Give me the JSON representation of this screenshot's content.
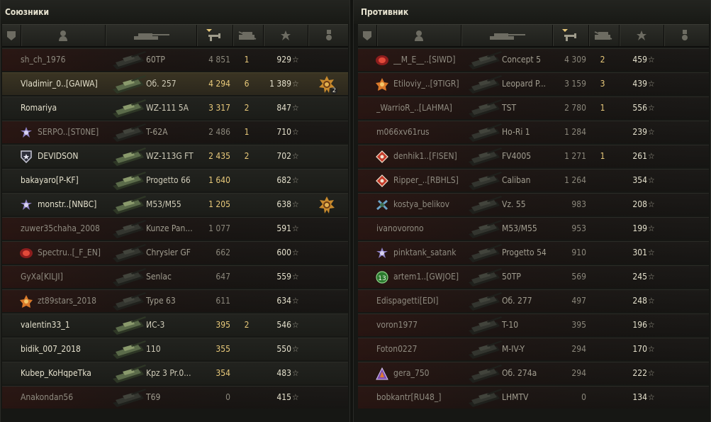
{
  "allies": {
    "title": "Союзники",
    "rows": [
      {
        "name": "sh_ch_1976",
        "tank": "60TP",
        "damage": "4 851",
        "kills": "1",
        "xp": "929",
        "alive": false,
        "emblem": "",
        "medal": ""
      },
      {
        "name": "Vladimir_0..[GAIWA]",
        "tank": "Об. 257",
        "damage": "4 294",
        "kills": "6",
        "xp": "1 389",
        "alive": true,
        "highlight": true,
        "emblem": "",
        "medal": "medal-2",
        "medal_count": "2"
      },
      {
        "name": "Romariya",
        "tank": "WZ-111 5A",
        "damage": "3 317",
        "kills": "2",
        "xp": "847",
        "alive": true,
        "emblem": "",
        "medal": ""
      },
      {
        "name": "SERPO..[ST0NE]",
        "tank": "T-62A",
        "damage": "2 486",
        "kills": "1",
        "xp": "710",
        "alive": false,
        "emblem": "star-emblem",
        "medal": ""
      },
      {
        "name": "DEVIDSON",
        "tank": "WZ-113G FT",
        "damage": "2 435",
        "kills": "2",
        "xp": "702",
        "alive": true,
        "emblem": "shield-emblem",
        "medal": ""
      },
      {
        "name": "bakayaro[P-KF]",
        "tank": "Progetto 66",
        "damage": "1 640",
        "kills": "",
        "xp": "682",
        "alive": true,
        "emblem": "",
        "medal": ""
      },
      {
        "name": "monstr..[NNBC]",
        "tank": "M53/M55",
        "damage": "1 205",
        "kills": "",
        "xp": "638",
        "alive": true,
        "emblem": "star-emblem",
        "medal": "medal-1",
        "medal_count": ""
      },
      {
        "name": "zuwer35chaha_2008",
        "tank": "Kunze Pan...",
        "damage": "1 077",
        "kills": "",
        "xp": "591",
        "alive": false,
        "emblem": "",
        "medal": ""
      },
      {
        "name": "Spectru..[_F_EN]",
        "tank": "Chrysler GF",
        "damage": "662",
        "kills": "",
        "xp": "600",
        "alive": false,
        "emblem": "red-emblem",
        "medal": ""
      },
      {
        "name": "GyXa[KILJI]",
        "tank": "Senlac",
        "damage": "647",
        "kills": "",
        "xp": "559",
        "alive": false,
        "emblem": "",
        "medal": ""
      },
      {
        "name": "zt89stars_2018",
        "tank": "Type 63",
        "damage": "611",
        "kills": "",
        "xp": "634",
        "alive": false,
        "emblem": "orange-emblem",
        "medal": ""
      },
      {
        "name": "valentin33_1",
        "tank": "ИС-3",
        "damage": "395",
        "kills": "2",
        "xp": "546",
        "alive": true,
        "emblem": "",
        "medal": ""
      },
      {
        "name": "bidik_007_2018",
        "tank": "110",
        "damage": "355",
        "kills": "",
        "xp": "550",
        "alive": true,
        "emblem": "",
        "medal": ""
      },
      {
        "name": "Kubep_KoHqpeTka",
        "tank": "Kpz 3 Pr.0...",
        "damage": "354",
        "kills": "",
        "xp": "483",
        "alive": true,
        "emblem": "",
        "medal": ""
      },
      {
        "name": "Anakondan56",
        "tank": "T69",
        "damage": "0",
        "kills": "",
        "xp": "415",
        "alive": false,
        "emblem": "",
        "medal": ""
      }
    ]
  },
  "enemies": {
    "title": "Противник",
    "rows": [
      {
        "name": "__M_E__..[SIWD]",
        "tank": "Concept 5",
        "damage": "4 309",
        "kills": "2",
        "xp": "459",
        "alive": false,
        "emblem": "red-emblem"
      },
      {
        "name": "Etiloviy_..[9TIGR]",
        "tank": "Leopard P...",
        "damage": "3 159",
        "kills": "3",
        "xp": "439",
        "alive": false,
        "emblem": "orange-emblem"
      },
      {
        "name": "_WarrioR_..[LAHMA]",
        "tank": "TST",
        "damage": "2 780",
        "kills": "1",
        "xp": "556",
        "alive": false,
        "emblem": ""
      },
      {
        "name": "m066xv61rus",
        "tank": "Ho-Ri 1",
        "damage": "1 284",
        "kills": "",
        "xp": "239",
        "alive": false,
        "emblem": ""
      },
      {
        "name": "denhik1..[FISEN]",
        "tank": "FV4005",
        "damage": "1 271",
        "kills": "1",
        "xp": "261",
        "alive": false,
        "emblem": "diamond-emblem"
      },
      {
        "name": "Ripper_..[RBHLS]",
        "tank": "Caliban",
        "damage": "1 264",
        "kills": "",
        "xp": "354",
        "alive": false,
        "emblem": "diamond-emblem"
      },
      {
        "name": "kostya_belikov",
        "tank": "Vz. 55",
        "damage": "983",
        "kills": "",
        "xp": "208",
        "alive": false,
        "emblem": "cross-emblem"
      },
      {
        "name": "ivanovorono",
        "tank": "M53/M55",
        "damage": "953",
        "kills": "",
        "xp": "199",
        "alive": false,
        "emblem": ""
      },
      {
        "name": "pinktank_satank",
        "tank": "Progetto 54",
        "damage": "910",
        "kills": "",
        "xp": "301",
        "alive": false,
        "emblem": "star-emblem"
      },
      {
        "name": "artem1..[GWJOE]",
        "tank": "50TP",
        "damage": "569",
        "kills": "",
        "xp": "245",
        "alive": false,
        "emblem": "green-emblem"
      },
      {
        "name": "Edispagetti[EDI]",
        "tank": "Об. 277",
        "damage": "497",
        "kills": "",
        "xp": "248",
        "alive": false,
        "emblem": ""
      },
      {
        "name": "voron1977",
        "tank": "T-10",
        "damage": "395",
        "kills": "",
        "xp": "196",
        "alive": false,
        "emblem": ""
      },
      {
        "name": "Foton0227",
        "tank": "M-IV-Y",
        "damage": "294",
        "kills": "",
        "xp": "170",
        "alive": false,
        "emblem": ""
      },
      {
        "name": "gera_750",
        "tank": "Об. 274a",
        "damage": "294",
        "kills": "",
        "xp": "222",
        "alive": false,
        "emblem": "purple-emblem"
      },
      {
        "name": "bobkantr[RU48_]",
        "tank": "LHMTV",
        "damage": "0",
        "kills": "",
        "xp": "134",
        "alive": false,
        "emblem": ""
      }
    ]
  },
  "columns": [
    "squad-icon",
    "player-icon",
    "tank-icon",
    "damage-sort-icon",
    "kills-icon",
    "xp-icon",
    "medal-icon"
  ],
  "star_glyph": "☆",
  "colors": {
    "accent": "#e8c97a",
    "text": "#e4e0cc",
    "dead_text": "#8f8b80"
  }
}
